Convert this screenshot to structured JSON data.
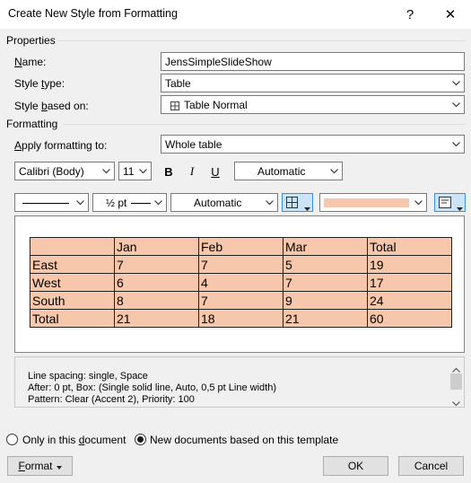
{
  "window": {
    "title": "Create New Style from Formatting",
    "help_glyph": "?",
    "close_glyph": "✕"
  },
  "properties": {
    "section_label": "Properties",
    "name_label": "Name:",
    "name_value": "JensSimpleSlideShow",
    "style_type_label": "Style type:",
    "style_type_value": "Table",
    "based_on_label": "Style based on:",
    "based_on_value": "Table Normal",
    "based_on_icon": "table-grid-icon"
  },
  "formatting": {
    "section_label": "Formatting",
    "apply_label": "Apply formatting to:",
    "apply_value": "Whole table",
    "font_name": "Calibri (Body)",
    "font_size": "11",
    "bold": "B",
    "italic": "I",
    "underline": "U",
    "font_color": "Automatic",
    "line_style": "line-style",
    "line_weight": "½ pt",
    "border_color": "Automatic",
    "shading_color": "#f7c7ac"
  },
  "preview": {
    "rows": [
      [
        "",
        "Jan",
        "Feb",
        "Mar",
        "Total"
      ],
      [
        "East",
        "7",
        "7",
        "5",
        "19"
      ],
      [
        "West",
        "6",
        "4",
        "7",
        "17"
      ],
      [
        "South",
        "8",
        "7",
        "9",
        "24"
      ],
      [
        "Total",
        "21",
        "18",
        "21",
        "60"
      ]
    ]
  },
  "description": {
    "line1": "Line spacing:  single, Space",
    "line2": "After:  0 pt, Box: (Single solid line, Auto,  0,5 pt Line width)",
    "line3": "Pattern: Clear (Accent 2), Priority: 100"
  },
  "options": {
    "only_doc": "Only in this document",
    "new_docs": "New documents based on this template",
    "selected": "new_docs"
  },
  "buttons": {
    "format": "Format",
    "ok": "OK",
    "cancel": "Cancel"
  }
}
